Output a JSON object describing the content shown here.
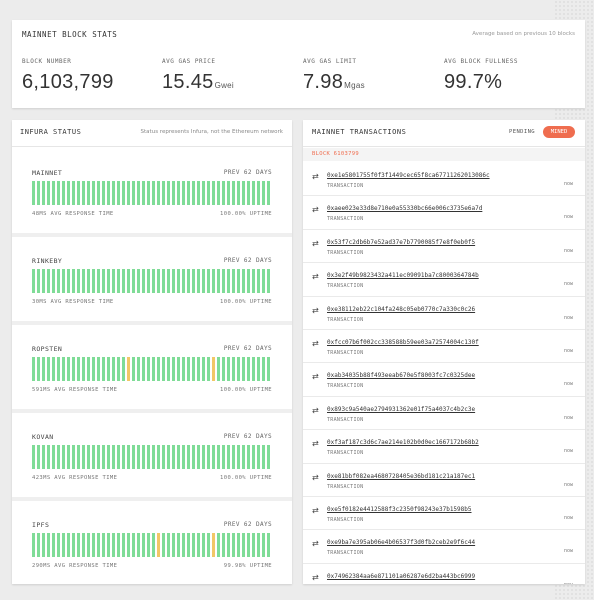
{
  "block_stats": {
    "title": "MAINNET BLOCK STATS",
    "note": "Average based on previous 10 blocks",
    "items": [
      {
        "label": "BLOCK NUMBER",
        "value": "6,103,799",
        "unit": ""
      },
      {
        "label": "AVG GAS PRICE",
        "value": "15.45",
        "unit": "Gwei"
      },
      {
        "label": "AVG GAS LIMIT",
        "value": "7.98",
        "unit": "Mgas"
      },
      {
        "label": "AVG BLOCK FULLNESS",
        "value": "99.7%",
        "unit": ""
      }
    ]
  },
  "status": {
    "title": "INFURA STATUS",
    "note": "Status represents Infura, not the Ethereum network",
    "bars_per_network": 48,
    "networks": [
      {
        "name": "MAINNET",
        "prev": "PREV 62 DAYS",
        "response": "48MS AVG RESPONSE TIME",
        "uptime": "100.00% UPTIME",
        "warn_bars": []
      },
      {
        "name": "RINKEBY",
        "prev": "PREV 62 DAYS",
        "response": "30MS AVG RESPONSE TIME",
        "uptime": "100.00% UPTIME",
        "warn_bars": []
      },
      {
        "name": "ROPSTEN",
        "prev": "PREV 62 DAYS",
        "response": "591MS AVG RESPONSE TIME",
        "uptime": "100.00% UPTIME",
        "warn_bars": [
          19,
          36
        ]
      },
      {
        "name": "KOVAN",
        "prev": "PREV 62 DAYS",
        "response": "423MS AVG RESPONSE TIME",
        "uptime": "100.00% UPTIME",
        "warn_bars": []
      },
      {
        "name": "IPFS",
        "prev": "PREV 62 DAYS",
        "response": "290MS AVG RESPONSE TIME",
        "uptime": "99.98% UPTIME",
        "warn_bars": [
          25,
          36
        ]
      }
    ]
  },
  "transactions": {
    "title": "MAINNET TRANSACTIONS",
    "pending_label": "PENDING",
    "mined_label": "MINED",
    "block_label": "BLOCK 6103799",
    "type_label": "TRANSACTION",
    "items": [
      {
        "hash": "0xe1e5801755f0f3f1449cec65f8ca67711262013086c",
        "age": "now"
      },
      {
        "hash": "0xaee023e33d8e710e0a55330bc66e006c3735e6a7d",
        "age": "now"
      },
      {
        "hash": "0x53f7c2db6b7e52ad37e7b7790085f7e8f0eb0f5",
        "age": "now"
      },
      {
        "hash": "0x3e2f49b9823432a411ec09091ba7c8000364784b",
        "age": "now"
      },
      {
        "hash": "0xe38112eb22c104fa248c05eb0770c7a330c0c26",
        "age": "now"
      },
      {
        "hash": "0xfcc07b6f002cc338588b59ee03a72574004c130f",
        "age": "now"
      },
      {
        "hash": "0xab34035b88f493eeab670e5f8003fc7c0325dee",
        "age": "now"
      },
      {
        "hash": "0x893c9a540ae2794931362e01f75a4037c4b2c3e",
        "age": "now"
      },
      {
        "hash": "0xf3af187c3d6c7ae214e102b0d0ec1667172b68b2",
        "age": "now"
      },
      {
        "hash": "0xe81bbf082ea4680728405e36bd181c21a187ec1",
        "age": "now"
      },
      {
        "hash": "0xe5f0182e4412588f3c2350f98243e37b1598b5",
        "age": "now"
      },
      {
        "hash": "0xe9ba7e395ab06e4b06537f3d0fb2ceb2e9f6c44",
        "age": "now"
      },
      {
        "hash": "0x74962384aa6e871101a06287e6d2ba443bc6999",
        "age": "now"
      }
    ]
  }
}
